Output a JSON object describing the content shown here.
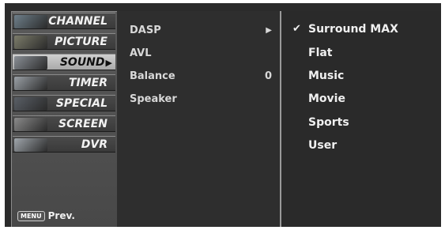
{
  "left_menu": {
    "items": [
      {
        "label": "CHANNEL",
        "active": false,
        "thumb": "#6e7f8a"
      },
      {
        "label": "PICTURE",
        "active": false,
        "thumb": "#7c7c6a"
      },
      {
        "label": "SOUND",
        "active": true,
        "thumb": "#8a8f96"
      },
      {
        "label": "TIMER",
        "active": false,
        "thumb": "#9aa0a6"
      },
      {
        "label": "SPECIAL",
        "active": false,
        "thumb": "#5a5f66"
      },
      {
        "label": "SCREEN",
        "active": false,
        "thumb": "#8a8a8a"
      },
      {
        "label": "DVR",
        "active": false,
        "thumb": "#a0a6ac"
      }
    ],
    "active_arrow": "▶",
    "prev_button": "MENU",
    "prev_label": "Prev."
  },
  "sound_menu": {
    "items": [
      {
        "label": "DASP",
        "value": "▶"
      },
      {
        "label": "AVL",
        "value": ""
      },
      {
        "label": "Balance",
        "value": "0"
      },
      {
        "label": "Speaker",
        "value": ""
      }
    ]
  },
  "dasp_options": {
    "selected_mark": "✔",
    "items": [
      "Surround MAX",
      "Flat",
      "Music",
      "Movie",
      "Sports",
      "User"
    ]
  }
}
